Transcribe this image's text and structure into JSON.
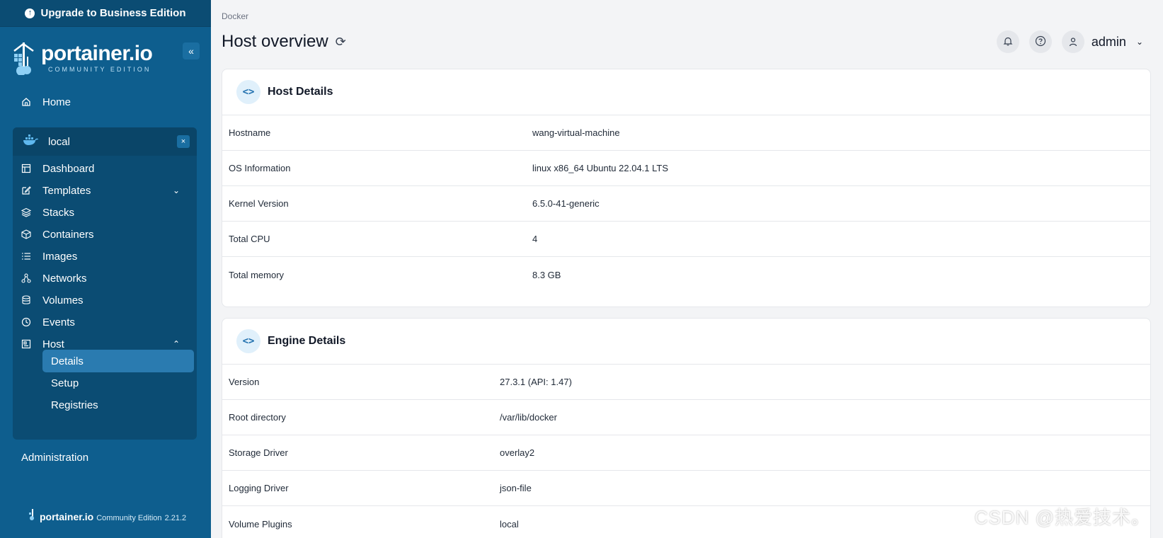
{
  "upgrade_banner": "Upgrade to Business Edition",
  "brand": {
    "name": "portainer.io",
    "edition": "COMMUNITY EDITION"
  },
  "sidebar": {
    "home": "Home",
    "environment": "local",
    "items": [
      {
        "label": "Dashboard",
        "icon": "dashboard-icon"
      },
      {
        "label": "Templates",
        "icon": "edit-icon"
      },
      {
        "label": "Stacks",
        "icon": "layers-icon"
      },
      {
        "label": "Containers",
        "icon": "box-icon"
      },
      {
        "label": "Images",
        "icon": "list-icon"
      },
      {
        "label": "Networks",
        "icon": "network-icon"
      },
      {
        "label": "Volumes",
        "icon": "database-icon"
      },
      {
        "label": "Events",
        "icon": "clock-icon"
      },
      {
        "label": "Host",
        "icon": "host-icon"
      }
    ],
    "host_sub": [
      "Details",
      "Setup",
      "Registries"
    ],
    "administration": "Administration",
    "footer": {
      "name": "portainer.io",
      "edition": "Community Edition",
      "version": "2.21.2"
    }
  },
  "header": {
    "breadcrumb": "Docker",
    "title": "Host overview",
    "user": "admin"
  },
  "host_details": {
    "title": "Host Details",
    "rows": [
      {
        "key": "Hostname",
        "value": "wang-virtual-machine"
      },
      {
        "key": "OS Information",
        "value": "linux x86_64 Ubuntu 22.04.1 LTS"
      },
      {
        "key": "Kernel Version",
        "value": "6.5.0-41-generic"
      },
      {
        "key": "Total CPU",
        "value": "4"
      },
      {
        "key": "Total memory",
        "value": "8.3 GB"
      }
    ]
  },
  "engine_details": {
    "title": "Engine Details",
    "rows": [
      {
        "key": "Version",
        "value": "27.3.1 (API: 1.47)"
      },
      {
        "key": "Root directory",
        "value": "/var/lib/docker"
      },
      {
        "key": "Storage Driver",
        "value": "overlay2"
      },
      {
        "key": "Logging Driver",
        "value": "json-file"
      },
      {
        "key": "Volume Plugins",
        "value": "local"
      }
    ]
  },
  "watermark": "CSDN @热爱技术。"
}
